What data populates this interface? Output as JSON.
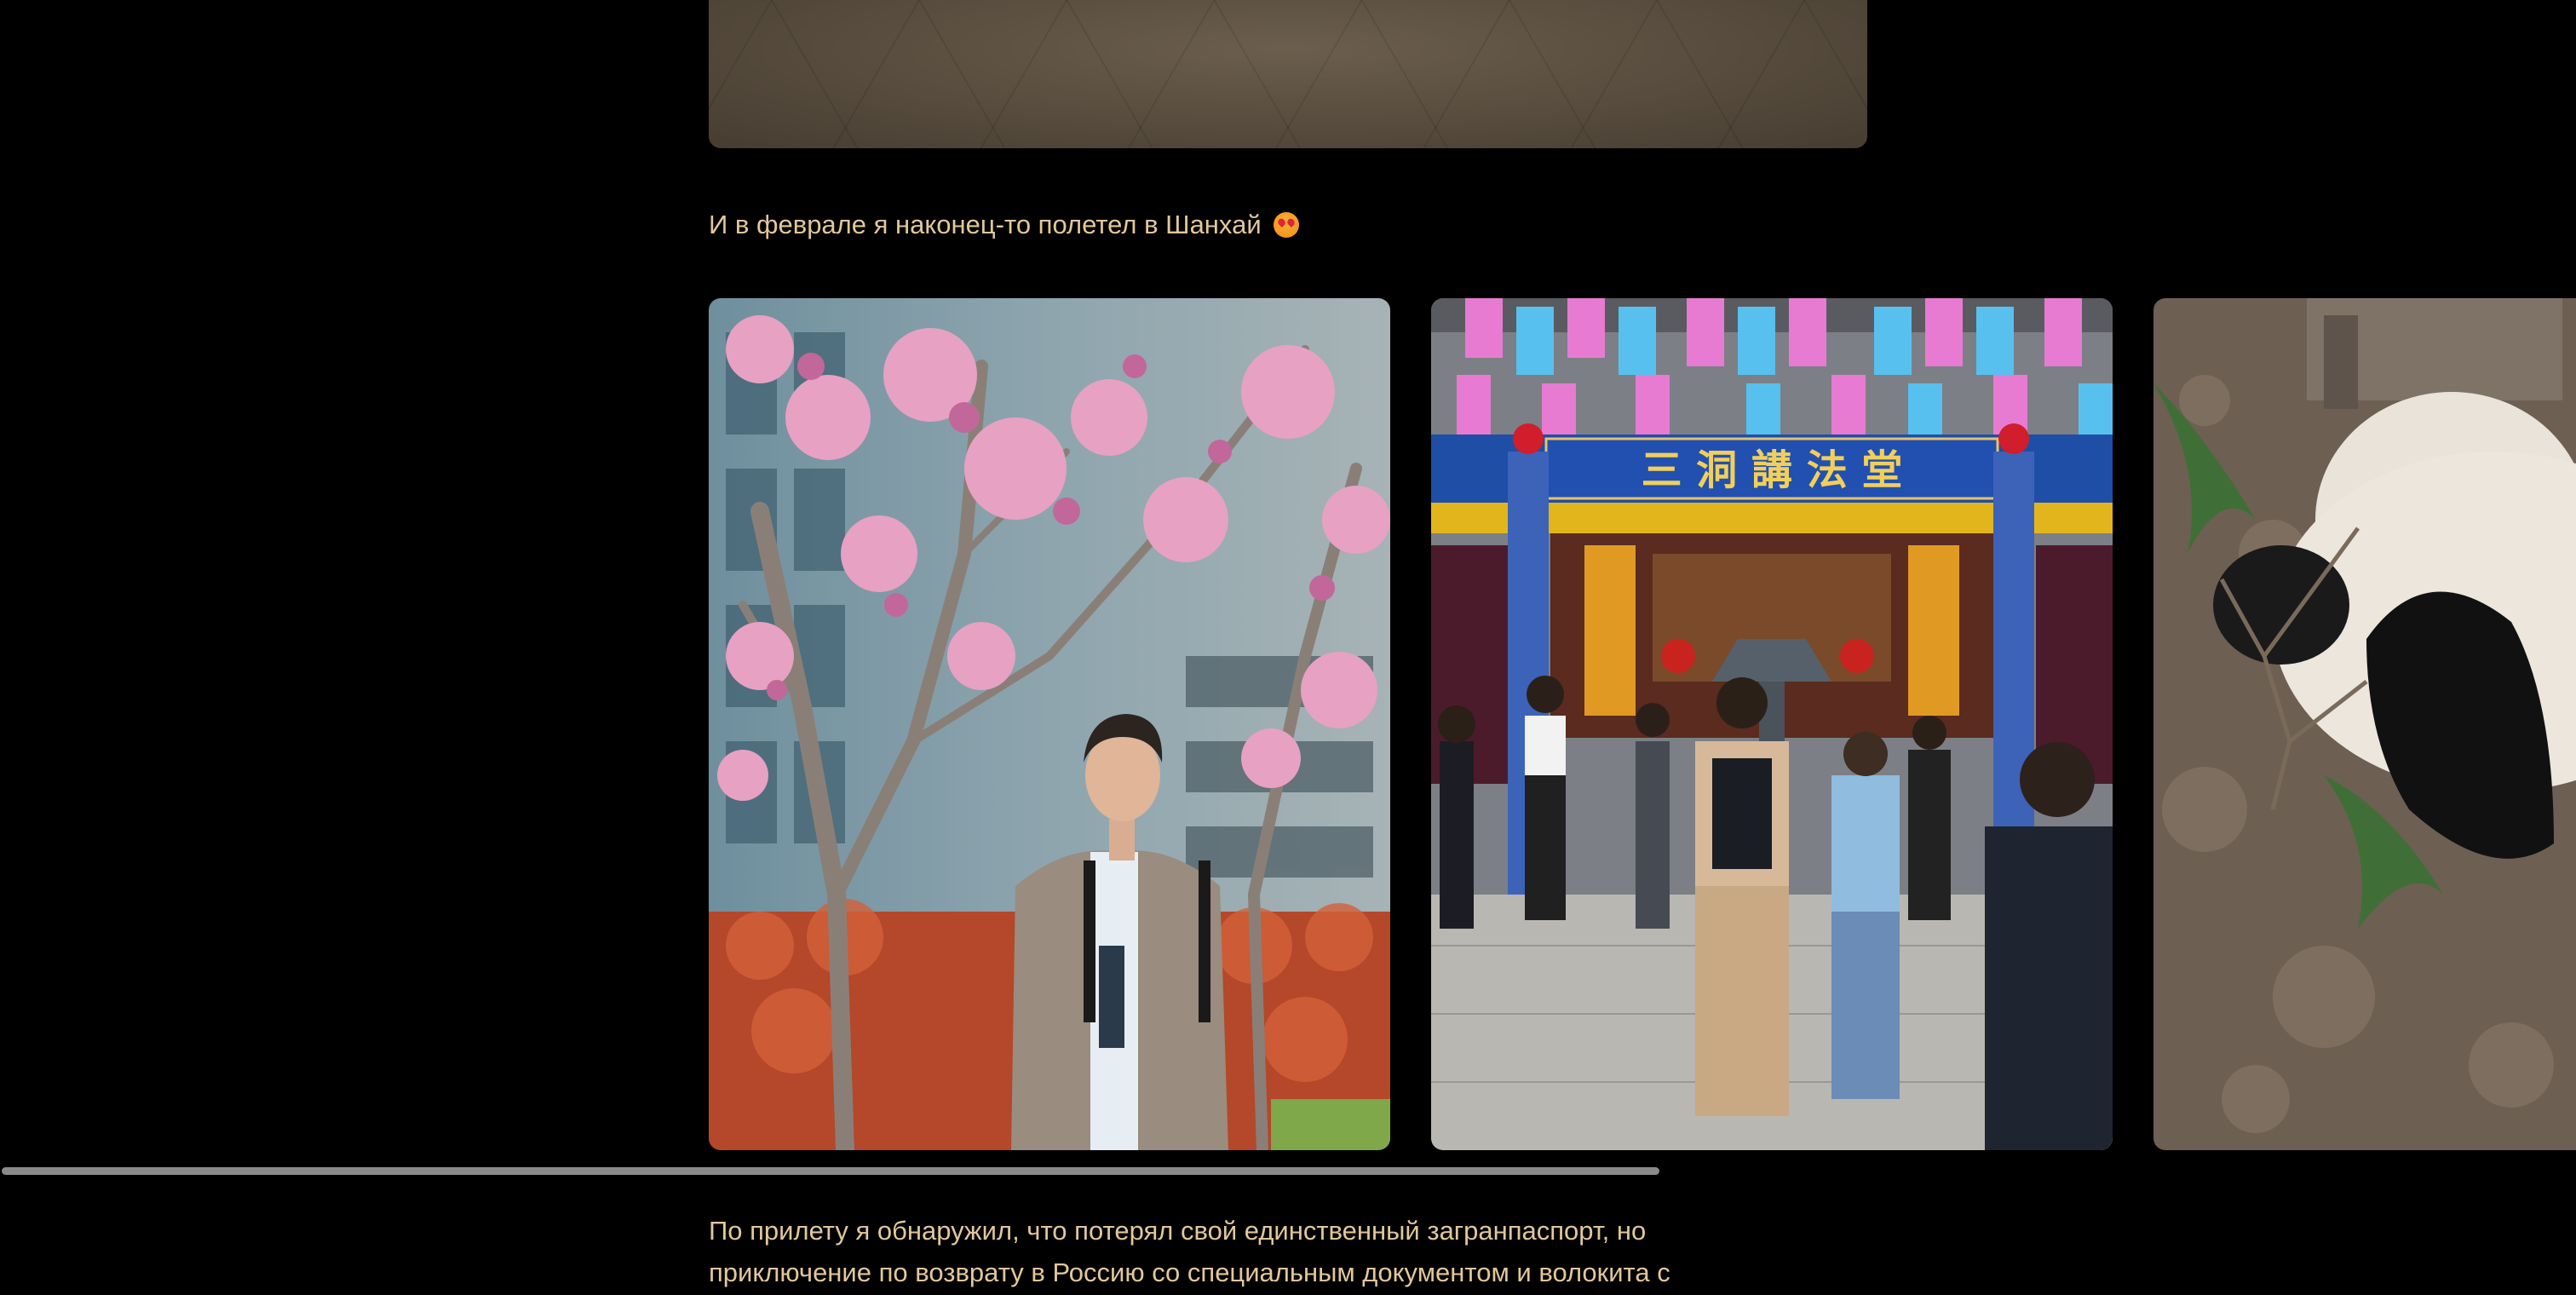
{
  "post": {
    "caption": "И в феврале я наконец-то полетел в Шанхай",
    "caption_emoji": "😍",
    "paragraph_line_1": "По прилету я обнаружил, что потерял свой единственный загранпаспорт, но",
    "paragraph_line_2": "приключение по возврату в Россию со специальным документом и волокита с"
  },
  "gallery": {
    "slides": [
      {
        "name": "magnolia-photo"
      },
      {
        "name": "temple-photo",
        "sign_text": "三 洞 講 法 堂"
      },
      {
        "name": "panda-photo"
      }
    ],
    "scroll_fraction": 0.64
  },
  "colors": {
    "background": "#000000",
    "text": "#e2c79a",
    "scroll_thumb": "#8a8a8a"
  }
}
